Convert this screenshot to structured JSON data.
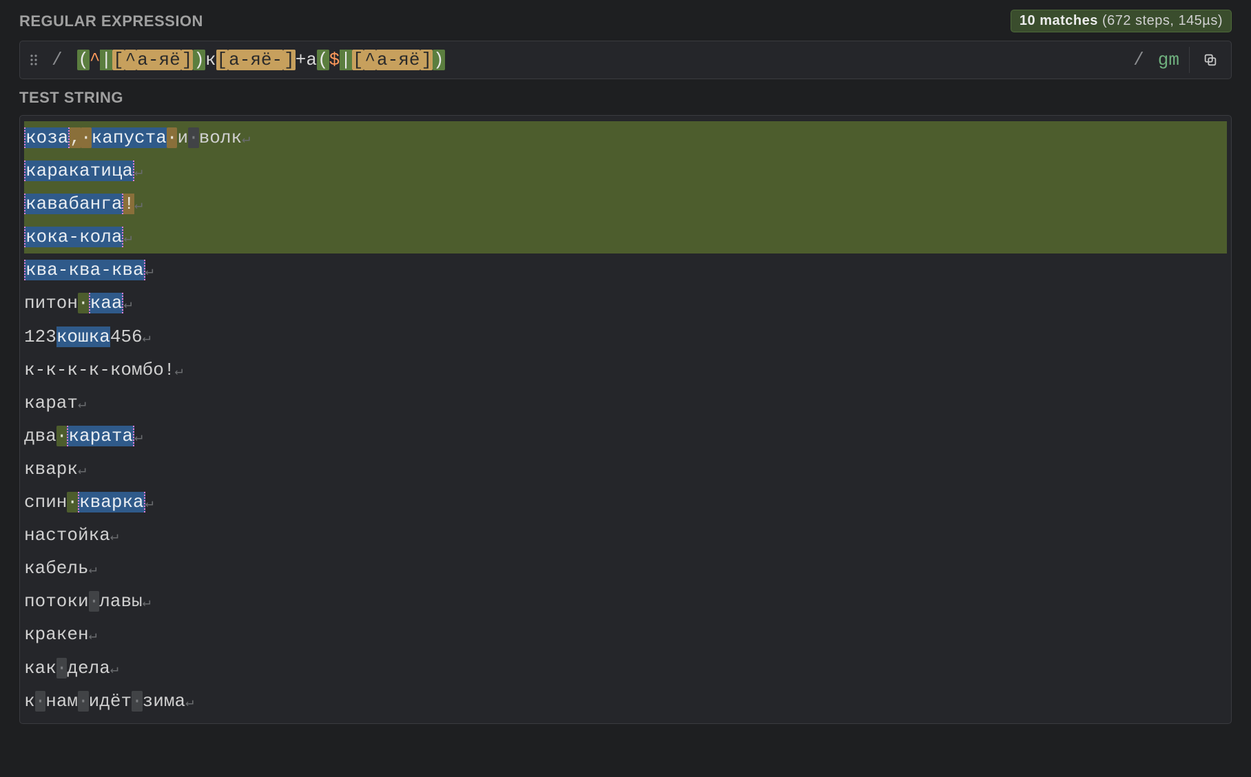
{
  "labels": {
    "regex_section": "REGULAR EXPRESSION",
    "test_section": "TEST STRING"
  },
  "match_info": {
    "count_label": "10 matches",
    "detail": "(672 steps, 145µs)"
  },
  "regex": {
    "open_paren1": "(",
    "caret": "^",
    "pipe1": "|",
    "cc1_open": "[",
    "cc1_neg": "^",
    "cc1_body": "а-яё",
    "cc1_close": "]",
    "close_paren1": ")",
    "lit_k": "к",
    "cc2_open": "[",
    "cc2_body": "а-яё-",
    "cc2_close": "]",
    "plus": "+",
    "lit_a": "а",
    "open_paren2": "(",
    "dollar": "$",
    "pipe2": "|",
    "cc3_open": "[",
    "cc3_neg": "^",
    "cc3_body": "а-яё",
    "cc3_close": "]",
    "close_paren2": ")",
    "flags": "gm"
  },
  "test": {
    "nl": "↵",
    "space_glyph": "·",
    "lines": [
      {
        "full_green": true,
        "segments": [
          {
            "text": "коза",
            "class": "hl-blue pink-border"
          },
          {
            "text": ",",
            "class": "hl-brown"
          },
          {
            "text": " ",
            "class": "ws hl-brown"
          },
          {
            "text": "капуста",
            "class": "hl-blue"
          },
          {
            "text": " ",
            "class": "ws hl-brown"
          },
          {
            "text": "и",
            "class": "plain"
          },
          {
            "text": " ",
            "class": "ws"
          },
          {
            "text": "волк",
            "class": "plain"
          }
        ]
      },
      {
        "full_green": true,
        "segments": [
          {
            "text": "каракатица",
            "class": "hl-blue pink-border"
          }
        ]
      },
      {
        "full_green": true,
        "segments": [
          {
            "text": "кавабанга",
            "class": "hl-blue pink-border"
          },
          {
            "text": "!",
            "class": "hl-brown"
          }
        ]
      },
      {
        "full_green": true,
        "segments": [
          {
            "text": "кока-кола",
            "class": "hl-blue pink-border"
          }
        ]
      },
      {
        "segments": [
          {
            "text": "ква-ква-ква",
            "class": "hl-blue pink-border"
          }
        ]
      },
      {
        "segments": [
          {
            "text": "питон",
            "class": "plain"
          },
          {
            "text": " ",
            "class": "ws hl-olive"
          },
          {
            "text": "каа",
            "class": "hl-blue pink-border"
          }
        ]
      },
      {
        "segments": [
          {
            "text": "123",
            "class": "num-plain"
          },
          {
            "text": "кошка",
            "class": "hl-blue"
          },
          {
            "text": "456",
            "class": "num-plain"
          }
        ]
      },
      {
        "segments": [
          {
            "text": "к-к-к-к-комбо!",
            "class": "plain"
          }
        ]
      },
      {
        "segments": [
          {
            "text": "карат",
            "class": "plain"
          }
        ]
      },
      {
        "segments": [
          {
            "text": "два",
            "class": "plain"
          },
          {
            "text": " ",
            "class": "ws hl-olive"
          },
          {
            "text": "карата",
            "class": "hl-blue pink-border"
          }
        ]
      },
      {
        "segments": [
          {
            "text": "кварк",
            "class": "plain"
          }
        ]
      },
      {
        "segments": [
          {
            "text": "спин",
            "class": "plain"
          },
          {
            "text": " ",
            "class": "ws hl-olive"
          },
          {
            "text": "кварка",
            "class": "hl-blue pink-border"
          }
        ]
      },
      {
        "segments": [
          {
            "text": "настойка",
            "class": "plain"
          }
        ]
      },
      {
        "segments": [
          {
            "text": "кабель",
            "class": "plain"
          }
        ]
      },
      {
        "segments": [
          {
            "text": "потоки",
            "class": "plain"
          },
          {
            "text": " ",
            "class": "ws"
          },
          {
            "text": "лавы",
            "class": "plain"
          }
        ]
      },
      {
        "segments": [
          {
            "text": "кракен",
            "class": "plain"
          }
        ]
      },
      {
        "segments": [
          {
            "text": "как",
            "class": "plain"
          },
          {
            "text": " ",
            "class": "ws"
          },
          {
            "text": "дела",
            "class": "plain"
          }
        ]
      },
      {
        "segments": [
          {
            "text": "к",
            "class": "plain"
          },
          {
            "text": " ",
            "class": "ws"
          },
          {
            "text": "нам",
            "class": "plain"
          },
          {
            "text": " ",
            "class": "ws"
          },
          {
            "text": "идёт",
            "class": "plain"
          },
          {
            "text": " ",
            "class": "ws"
          },
          {
            "text": "зима",
            "class": "plain"
          }
        ]
      }
    ]
  }
}
